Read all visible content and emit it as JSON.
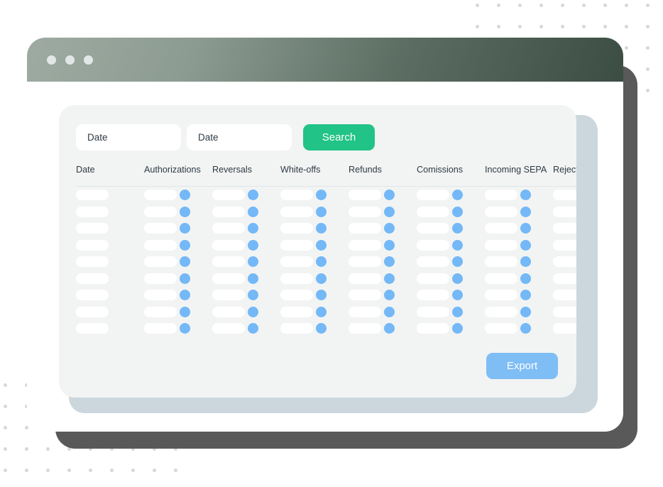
{
  "window": {
    "traffic_lights": [
      "close-dot",
      "minimize-dot",
      "maximize-dot"
    ],
    "titlebar_gradient_from": "#9EABA2",
    "titlebar_gradient_to": "#3C4D44"
  },
  "filters": {
    "date_from": {
      "value": "",
      "placeholder": "Date"
    },
    "date_to": {
      "value": "",
      "placeholder": "Date"
    },
    "search_label": "Search",
    "search_color": "#22C387"
  },
  "table": {
    "columns": [
      "Date",
      "Authorizations",
      "Reversals",
      "White-offs",
      "Refunds",
      "Comissions",
      "Incoming SEPA",
      "Rejected by"
    ],
    "row_count": 9,
    "placeholder_style": "skeleton",
    "pill_color": "#FFFFFF",
    "dot_color": "#74B8F7"
  },
  "actions": {
    "export_label": "Export",
    "export_color": "#7FBDF5"
  },
  "decoration": {
    "dot_color": "#D3D9DE",
    "card_color": "#F2F4F3",
    "backplate_color": "#CBD7DD",
    "shadow_plate_color": "#595959"
  }
}
